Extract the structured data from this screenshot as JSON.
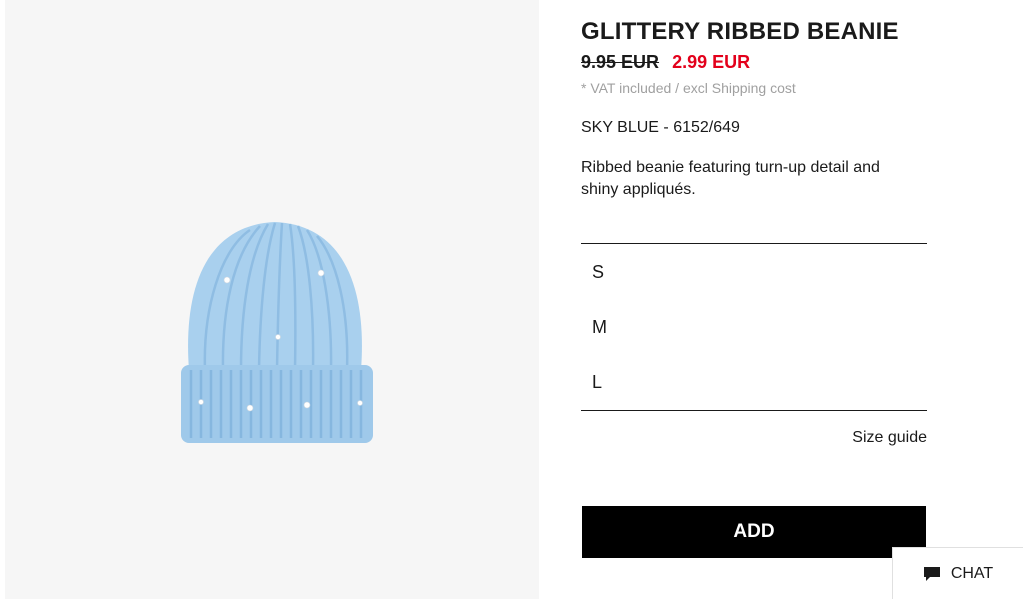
{
  "product": {
    "title": "GLITTERY RIBBED BEANIE",
    "old_price": "9.95 EUR",
    "new_price": "2.99 EUR",
    "vat_note": "* VAT included / excl Shipping cost",
    "color_ref": "SKY BLUE - 6152/649",
    "description": "Ribbed beanie featuring turn-up detail and shiny appliqués.",
    "image_icon": "beanie-image",
    "colors": {
      "beanie": "#a9d0ee",
      "sale": "#e3001b",
      "button": "#000000"
    }
  },
  "sizes": [
    "S",
    "M",
    "L"
  ],
  "size_guide_label": "Size guide",
  "add_label": "ADD",
  "chat": {
    "label": "CHAT",
    "icon": "chat-bubble-icon"
  }
}
